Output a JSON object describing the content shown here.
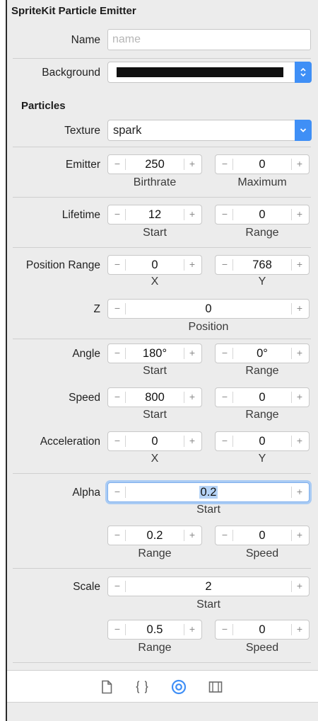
{
  "panel": {
    "title": "SpriteKit Particle Emitter",
    "name": {
      "label": "Name",
      "placeholder": "name",
      "value": ""
    },
    "background": {
      "label": "Background",
      "color": "#111111"
    },
    "particles_section": "Particles",
    "texture": {
      "label": "Texture",
      "value": "spark"
    },
    "emitter": {
      "label": "Emitter",
      "birthrate": "250",
      "birthrate_caption": "Birthrate",
      "maximum": "0",
      "maximum_caption": "Maximum"
    },
    "lifetime": {
      "label": "Lifetime",
      "start": "12",
      "start_caption": "Start",
      "range": "0",
      "range_caption": "Range"
    },
    "position_range": {
      "label": "Position Range",
      "x": "0",
      "x_caption": "X",
      "y": "768",
      "y_caption": "Y"
    },
    "position_z": {
      "label": "Z",
      "value": "0",
      "caption": "Position"
    },
    "angle": {
      "label": "Angle",
      "start": "180°",
      "start_caption": "Start",
      "range": "0°",
      "range_caption": "Range"
    },
    "speed": {
      "label": "Speed",
      "start": "800",
      "start_caption": "Start",
      "range": "0",
      "range_caption": "Range"
    },
    "acceleration": {
      "label": "Acceleration",
      "x": "0",
      "x_caption": "X",
      "y": "0",
      "y_caption": "Y"
    },
    "alpha": {
      "label": "Alpha",
      "start": "0.2",
      "start_caption": "Start",
      "range": "0.2",
      "range_caption": "Range",
      "speed": "0",
      "speed_caption": "Speed"
    },
    "scale": {
      "label": "Scale",
      "start": "2",
      "start_caption": "Start",
      "range": "0.5",
      "range_caption": "Range",
      "speed": "0",
      "speed_caption": "Speed"
    },
    "stepper_minus": "−",
    "stepper_plus": "+"
  },
  "toolbar": {
    "icons": [
      "file-inspector-icon",
      "quick-help-icon",
      "attributes-inspector-icon",
      "size-inspector-icon"
    ],
    "accent_color": "#3f8ff6"
  }
}
